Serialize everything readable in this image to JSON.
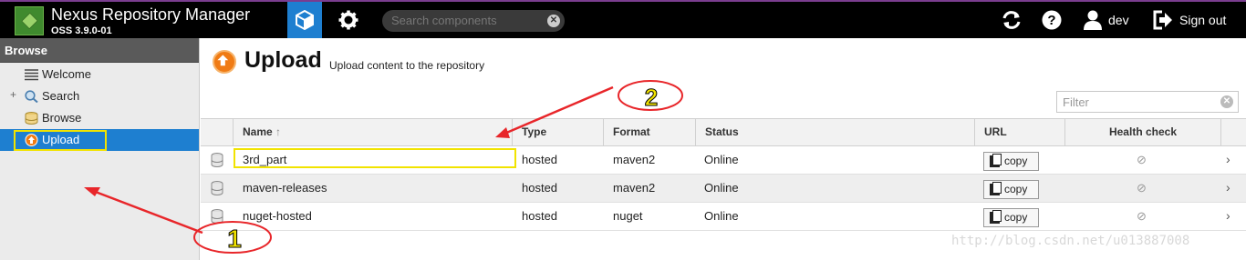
{
  "header": {
    "app_name": "Nexus Repository Manager",
    "version": "OSS 3.9.0-01",
    "search_placeholder": "Search components",
    "user": "dev",
    "signout": "Sign out"
  },
  "sidebar": {
    "title": "Browse",
    "items": [
      {
        "label": "Welcome",
        "icon": "welcome-icon"
      },
      {
        "label": "Search",
        "icon": "search-icon"
      },
      {
        "label": "Browse",
        "icon": "database-icon"
      },
      {
        "label": "Upload",
        "icon": "upload-icon"
      }
    ]
  },
  "main": {
    "title": "Upload",
    "subtitle": "Upload content to the repository",
    "filter_placeholder": "Filter",
    "columns": [
      "Name",
      "Type",
      "Format",
      "Status",
      "URL",
      "Health check"
    ],
    "copy_label": "copy",
    "rows": [
      {
        "name": "3rd_part",
        "type": "hosted",
        "format": "maven2",
        "status": "Online"
      },
      {
        "name": "maven-releases",
        "type": "hosted",
        "format": "maven2",
        "status": "Online"
      },
      {
        "name": "nuget-hosted",
        "type": "hosted",
        "format": "nuget",
        "status": "Online"
      }
    ]
  },
  "annotations": {
    "one": "1",
    "two": "2"
  },
  "watermark": "http://blog.csdn.net/u013887008",
  "colors": {
    "accent": "#1e7fd0",
    "highlight": "#f1e300",
    "arrow": "#e8262a",
    "upload": "#f07b14"
  }
}
